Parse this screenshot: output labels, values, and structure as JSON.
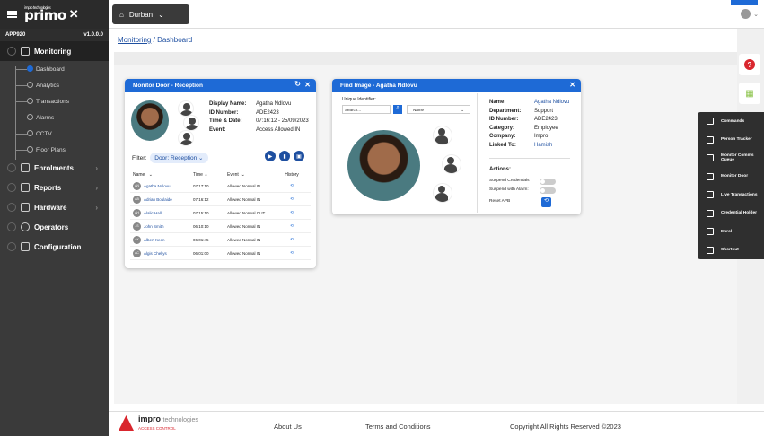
{
  "app": {
    "logo_small": "impro technologies",
    "logo": "primo",
    "site_code": "APP920",
    "version": "v1.0.0.0"
  },
  "sidebar": {
    "sections": [
      {
        "label": "Monitoring"
      },
      {
        "label": "Enrolments"
      },
      {
        "label": "Reports"
      },
      {
        "label": "Hardware"
      },
      {
        "label": "Operators"
      },
      {
        "label": "Configuration"
      }
    ],
    "sub": [
      "Dashboard",
      "Analytics",
      "Transactions",
      "Alarms",
      "CCTV",
      "Floor Plans"
    ]
  },
  "topbar": {
    "site": "Durban"
  },
  "breadcrumb": {
    "root": "Monitoring",
    "sep": "/",
    "current": "Dashboard"
  },
  "monitor_door": {
    "title": "Monitor Door - Reception",
    "display_name_label": "Display Name:",
    "display_name": "Agatha Ndlovu",
    "id_label": "ID Number:",
    "id": "ADE2423",
    "time_label": "Time & Date:",
    "time": "07:16:12 - 25/09/2023",
    "event_label": "Event:",
    "event": "Access Allowed IN",
    "filter_label": "Filter:",
    "filter_value": "Door: Reception",
    "columns": [
      "Name",
      "Time",
      "Event",
      "History"
    ],
    "rows": [
      {
        "ini": "AN",
        "name": "Agatha Ndlovu",
        "time": "07:17:10",
        "event": "Allowed Normal IN"
      },
      {
        "ini": "AB",
        "name": "Adrian Boulaide",
        "time": "07:16:12",
        "event": "Allowed Normal IN"
      },
      {
        "ini": "AH",
        "name": "Alalic Hall",
        "time": "07:15:10",
        "event": "Allowed Normal OUT"
      },
      {
        "ini": "JS",
        "name": "John Smith",
        "time": "06:10:10",
        "event": "Allowed Normal IN"
      },
      {
        "ini": "AK",
        "name": "Albert Keen",
        "time": "06:01:45",
        "event": "Allowed Normal IN"
      },
      {
        "ini": "AC",
        "name": "Algis Chellys",
        "time": "06:01:00",
        "event": "Allowed Normal IN"
      }
    ]
  },
  "find_image": {
    "title": "Find Image - Agatha Ndlovu",
    "uid_label": "Unique Identifier:",
    "search_placeholder": "Search...",
    "select": "Name",
    "name_label": "Name:",
    "name": "Agatha Ndlovu",
    "dept_label": "Department:",
    "dept": "Support",
    "id_label": "ID Number:",
    "id": "ADE2423",
    "cat_label": "Category:",
    "cat": "Employee",
    "company_label": "Company:",
    "company": "Impro",
    "linked_label": "Linked To:",
    "linked": "Hamish",
    "actions_label": "Actions:",
    "suspend_cred": "Suspend Credentials",
    "suspend_alarm": "Suspend with Alarm:",
    "reset": "Reset APB"
  },
  "context_menu": [
    "Commands",
    "Person Tracker",
    "Monitor Comms Queue",
    "Monitor Door",
    "Live Transactions",
    "Credential Holder",
    "Enrol",
    "Shortcut"
  ],
  "footer": {
    "brand": "impro",
    "brand2": "technologies",
    "brand_sub": "ACCESS CONTROL",
    "about": "About Us",
    "terms": "Terms and Conditions",
    "copyright": "Copyright All Rights Reserved ©2023"
  },
  "colors": {
    "accent": "#1e6ad6",
    "sidebar": "#3a3a3a",
    "brand_red": "#d9262e"
  }
}
